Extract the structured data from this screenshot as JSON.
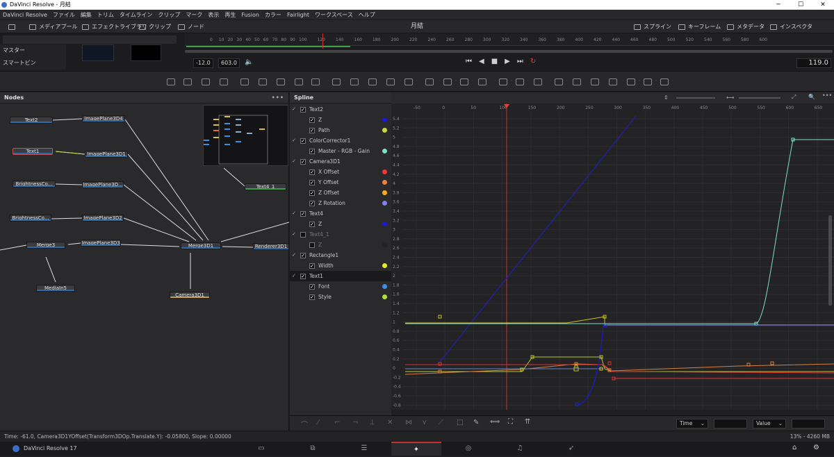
{
  "titlebar": {
    "title": "DaVinci Resolve - 月結",
    "minimize": "─",
    "maximize": "☐",
    "close": "✕"
  },
  "menu": [
    "DaVinci Resolve",
    "ファイル",
    "編集",
    "トリム",
    "タイムライン",
    "クリップ",
    "マーク",
    "表示",
    "再生",
    "Fusion",
    "カラー",
    "Fairlight",
    "ワークスペース",
    "ヘルプ"
  ],
  "toolbar": {
    "media_pool": "メディアプール",
    "effects_library": "エフェクトライブラリ",
    "clip": "クリップ",
    "nodes": "ノード",
    "page_title": "月結",
    "spline": "スプライン",
    "keyframes": "キーフレーム",
    "metadata": "メタデータ",
    "inspector": "インスペクタ"
  },
  "bins": [
    "マスター",
    "スマートビン"
  ],
  "ruler_ticks": [
    "0",
    "10",
    "20",
    "30",
    "40",
    "50",
    "60",
    "70",
    "80",
    "90",
    "100",
    "120",
    "140",
    "160",
    "180",
    "200",
    "220",
    "240",
    "260",
    "280",
    "300",
    "320",
    "340",
    "360",
    "380",
    "400",
    "420",
    "440",
    "460",
    "480",
    "500",
    "520",
    "540",
    "560",
    "580",
    "600"
  ],
  "playback": {
    "start": "-12.0",
    "end": "603.0",
    "current": "119.0"
  },
  "nodes_panel": {
    "title": "Nodes",
    "nodes": [
      "Text2",
      "ImagePlane3D4",
      "Text1",
      "ImagePlane3D1",
      "BrightnessCo...",
      "ImagePlane3D...",
      "Text4_1",
      "BrightnessCo...",
      "ImagePlane3D2",
      "Merge3",
      "ImagePlane3D3",
      "Merge3D1",
      "Renderer3D1",
      "MediaIn5",
      "Camera3D1"
    ]
  },
  "spline_panel": {
    "title": "Spline",
    "rows": [
      {
        "label": "Text2",
        "level": 0,
        "checked": true,
        "color": ""
      },
      {
        "label": "Z",
        "level": 1,
        "checked": true,
        "color": "#1a1ad0"
      },
      {
        "label": "Path",
        "level": 1,
        "checked": true,
        "color": "#c8d840"
      },
      {
        "label": "ColorCorrector1",
        "level": 0,
        "checked": true,
        "color": ""
      },
      {
        "label": "Master - RGB - Gain",
        "level": 1,
        "checked": true,
        "color": "#80e0c0"
      },
      {
        "label": "Camera3D1",
        "level": 0,
        "checked": true,
        "color": ""
      },
      {
        "label": "X Offset",
        "level": 1,
        "checked": true,
        "color": "#e83a3a"
      },
      {
        "label": "Y Offset",
        "level": 1,
        "checked": true,
        "color": "#f08040"
      },
      {
        "label": "Z Offset",
        "level": 1,
        "checked": true,
        "color": "#f0b020"
      },
      {
        "label": "Z Rotation",
        "level": 1,
        "checked": true,
        "color": "#8080f0"
      },
      {
        "label": "Text4",
        "level": 0,
        "checked": true,
        "color": ""
      },
      {
        "label": "Z",
        "level": 1,
        "checked": true,
        "color": "#1a1ad0"
      },
      {
        "label": "Text4_1",
        "level": 0,
        "checked": false,
        "color": ""
      },
      {
        "label": "Z",
        "level": 1,
        "checked": false,
        "color": "#222"
      },
      {
        "label": "Rectangle1",
        "level": 0,
        "checked": true,
        "color": ""
      },
      {
        "label": "Width",
        "level": 1,
        "checked": true,
        "color": "#e8e820"
      },
      {
        "label": "Text1",
        "level": 0,
        "checked": true,
        "color": "",
        "selected": true
      },
      {
        "label": "Font",
        "level": 1,
        "checked": true,
        "color": "#3a90e0"
      },
      {
        "label": "Style",
        "level": 1,
        "checked": true,
        "color": "#b0e040"
      }
    ]
  },
  "graph": {
    "x_ticks": [
      "-50",
      "0",
      "50",
      "100",
      "150",
      "200",
      "250",
      "300",
      "350",
      "400",
      "450",
      "500",
      "550",
      "600",
      "650"
    ],
    "y_ticks": [
      "5.4",
      "5.2",
      "5",
      "4.8",
      "4.6",
      "4.4",
      "4.2",
      "4",
      "3.8",
      "3.6",
      "3.4",
      "3.2",
      "3",
      "2.8",
      "2.6",
      "2.4",
      "2.2",
      "2",
      "1.8",
      "1.6",
      "1.4",
      "1.2",
      "1",
      "0.8",
      "0.6",
      "0.4",
      "0.2",
      "0",
      "-0.2",
      "-0.4",
      "-0.6",
      "-0.8"
    ]
  },
  "dropdowns": {
    "time": "Time",
    "value": "Value"
  },
  "status": {
    "text": "Time: -61.0,    Camera3D1YOffset(Transform3DOp.Translate.Y):  -0.05800,    Slope: 0.00000",
    "memory": "13% - 4260 MB"
  },
  "footer": {
    "app": "DaVinci Resolve 17"
  }
}
